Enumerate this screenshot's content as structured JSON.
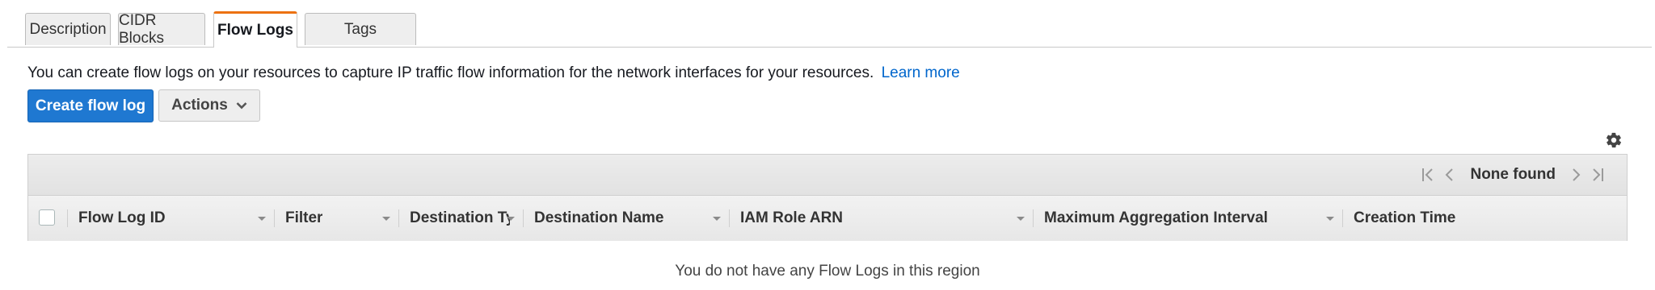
{
  "tabs": [
    {
      "label": "Description"
    },
    {
      "label": "CIDR Blocks"
    },
    {
      "label": "Flow Logs",
      "active": true
    },
    {
      "label": "Tags"
    }
  ],
  "intro": {
    "text": "You can create flow logs on your resources to capture IP traffic flow information for the network interfaces for your resources.",
    "link": "Learn more"
  },
  "toolbar": {
    "create_label": "Create flow log",
    "actions_label": "Actions"
  },
  "pagination": {
    "label": "None found"
  },
  "table": {
    "columns": [
      "Flow Log ID",
      "Filter",
      "Destination Type",
      "Destination Name",
      "IAM Role ARN",
      "Maximum Aggregation Interval",
      "Creation Time"
    ],
    "rows": [],
    "empty_message": "You do not have any Flow Logs in this region"
  },
  "colors": {
    "primary": "#1f78d1",
    "active_tab_accent": "#ec7211",
    "link": "#0066cc"
  },
  "icons": {
    "settings": "gear-icon",
    "actions_dropdown": "chevron-down-icon",
    "pager_first": "first-page-icon",
    "pager_prev": "prev-page-icon",
    "pager_next": "next-page-icon",
    "pager_last": "last-page-icon"
  }
}
